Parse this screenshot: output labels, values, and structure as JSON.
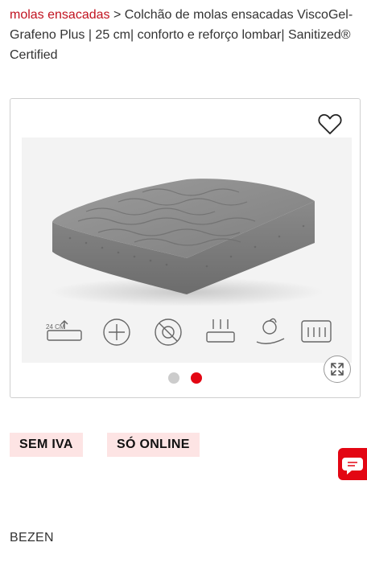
{
  "breadcrumb": {
    "parent_link": "molas ensacadas",
    "separator": " > ",
    "current": "Colchão de molas ensacadas ViscoGel-Grafeno Plus | 25 cm| conforto e reforço lombar| Sanitized® Certified"
  },
  "gallery": {
    "feature_icons": [
      "height-24cm-icon",
      "sanitized-icon",
      "no-bacteria-icon",
      "breathable-icon",
      "natural-hands-icon",
      "pocket-springs-icon"
    ],
    "feature_icon_texts": {
      "height": "24 CM"
    },
    "dots": [
      {
        "active": false
      },
      {
        "active": true
      }
    ],
    "colors": {
      "dot_inactive": "#cccccc",
      "dot_active": "#e30613"
    }
  },
  "badges": {
    "vat": "SEM IVA",
    "online": "SÓ ONLINE"
  },
  "brand": "BEZEN",
  "colors": {
    "accent": "#c1121f",
    "badge_bg": "#fde4e4",
    "chat_bg": "#e30613"
  }
}
